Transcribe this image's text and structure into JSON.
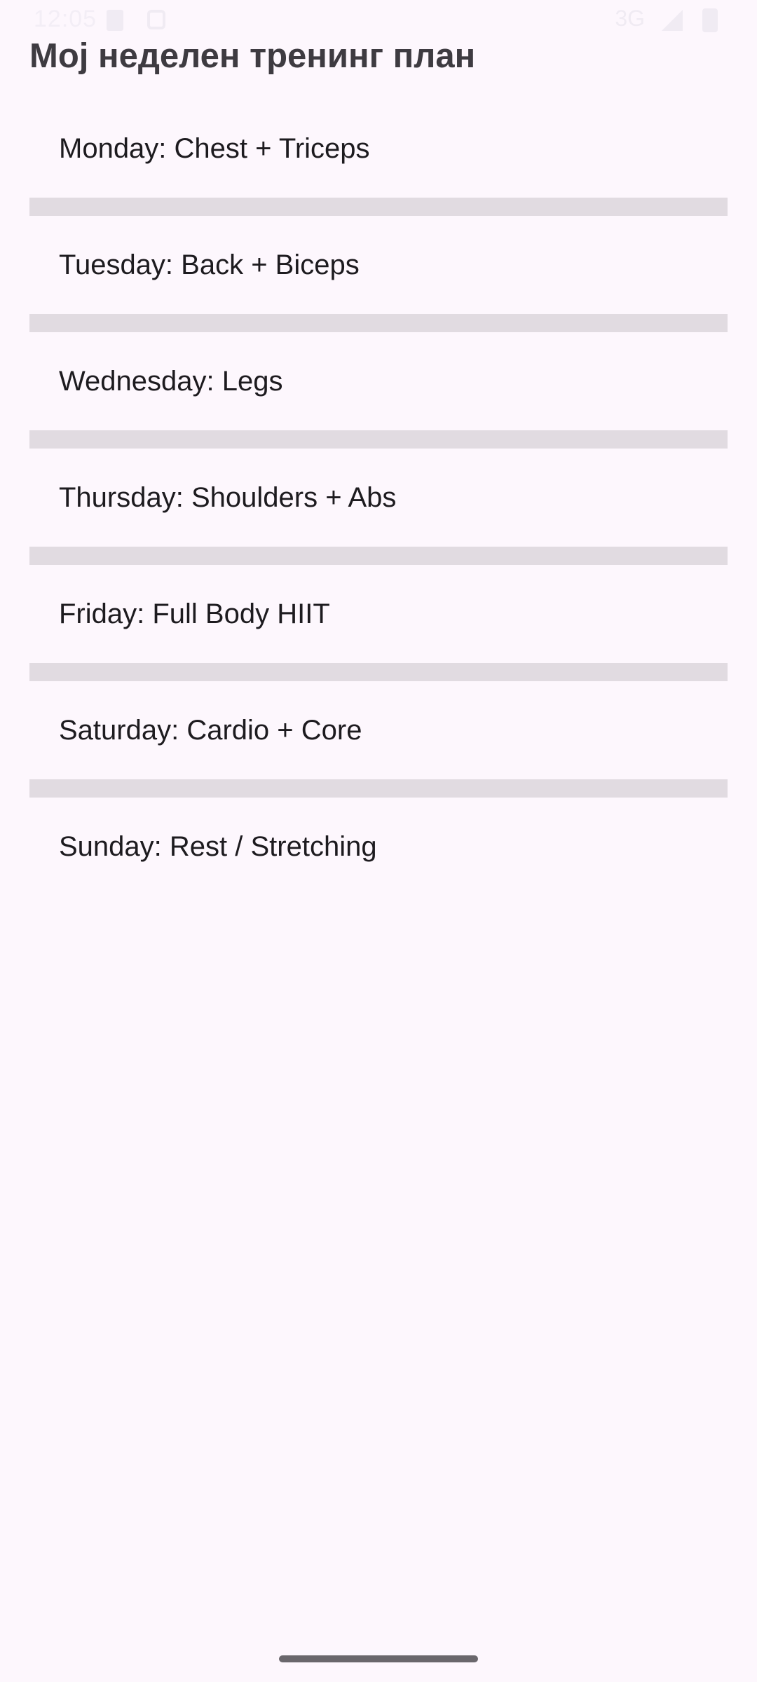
{
  "status_bar": {
    "time": "12:05",
    "network": "3G"
  },
  "header": {
    "title": "Мој неделен тренинг план"
  },
  "plan": {
    "items": [
      {
        "label": "Monday: Chest + Triceps"
      },
      {
        "label": "Tuesday: Back + Biceps"
      },
      {
        "label": "Wednesday: Legs"
      },
      {
        "label": "Thursday: Shoulders + Abs"
      },
      {
        "label": "Friday: Full Body HIIT"
      },
      {
        "label": "Saturday: Cardio + Core"
      },
      {
        "label": "Sunday: Rest / Stretching"
      }
    ]
  },
  "colors": {
    "background": "#fdf7fd",
    "divider": "#e1dbe1",
    "title_text": "#3e3b41",
    "item_text": "#1d1b1f"
  },
  "icons": [
    "sim-card-icon",
    "lock-icon",
    "signal-icon",
    "battery-icon"
  ]
}
